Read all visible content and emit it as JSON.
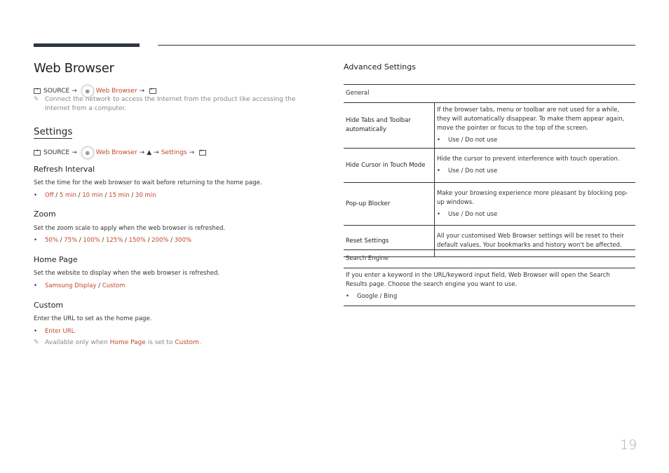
{
  "page": {
    "title": "Web Browser",
    "page_number": "19",
    "accent_color": "#c4462a"
  },
  "path1": {
    "source": "SOURCE",
    "arrow": "→",
    "web_browser": "Web Browser",
    "icons": [
      "source-icon",
      "web-browser-globe-icon",
      "enter-icon"
    ]
  },
  "note1": "Connect the network to access the Internet from the product like accessing the Internet from a computer.",
  "settings": {
    "heading": "Settings",
    "path": {
      "source": "SOURCE",
      "arrow": "→",
      "web_browser": "Web Browser",
      "up": "▲",
      "settings": "Settings"
    },
    "refresh": {
      "title": "Refresh Interval",
      "desc": "Set the time for the web browser to wait before returning to the home page.",
      "options": [
        "Off",
        "5 min",
        "10 min",
        "15 min",
        "30 min"
      ]
    },
    "zoom": {
      "title": "Zoom",
      "desc": "Set the zoom scale to apply when the web browser is refreshed.",
      "options": [
        "50%",
        "75%",
        "100%",
        "125%",
        "150%",
        "200%",
        "300%"
      ]
    },
    "home": {
      "title": "Home Page",
      "desc": "Set the website to display when the web browser is refreshed.",
      "options": [
        "Samsung Display",
        "Custom"
      ]
    },
    "custom": {
      "title": "Custom",
      "desc": "Enter the URL to set as the home page.",
      "options": [
        "Enter URL"
      ],
      "note_prefix": "Available only when ",
      "note_link1": "Home Page",
      "note_mid": " is set to ",
      "note_link2": "Custom",
      "note_suffix": "."
    }
  },
  "advanced": {
    "title": "Advanced Settings",
    "general": {
      "heading": "General",
      "rows": [
        {
          "label": "Hide Tabs and Toolbar automatically",
          "desc": "If the browser tabs, menu or toolbar are not used for a while, they will automatically disappear. To make them appear again, move the pointer or focus to the top of the screen.",
          "options": "Use / Do not use"
        },
        {
          "label": "Hide Cursor in Touch Mode",
          "desc": "Hide the cursor to prevent interference with touch operation.",
          "options": "Use / Do not use"
        },
        {
          "label": "Pop-up Blocker",
          "desc": "Make your browsing experience more pleasant by blocking pop-up windows.",
          "options": "Use / Do not use"
        },
        {
          "label": "Reset Settings",
          "desc": "All your customised Web Browser settings will be reset to their default values. Your bookmarks and history won't be affected.",
          "options": null
        }
      ]
    },
    "search": {
      "heading": "Search Engine",
      "desc": "If you enter a keyword in the URL/keyword input field, Web Browser will open the Search Results page. Choose the search engine you want to use.",
      "options": "Google / Bing"
    }
  }
}
